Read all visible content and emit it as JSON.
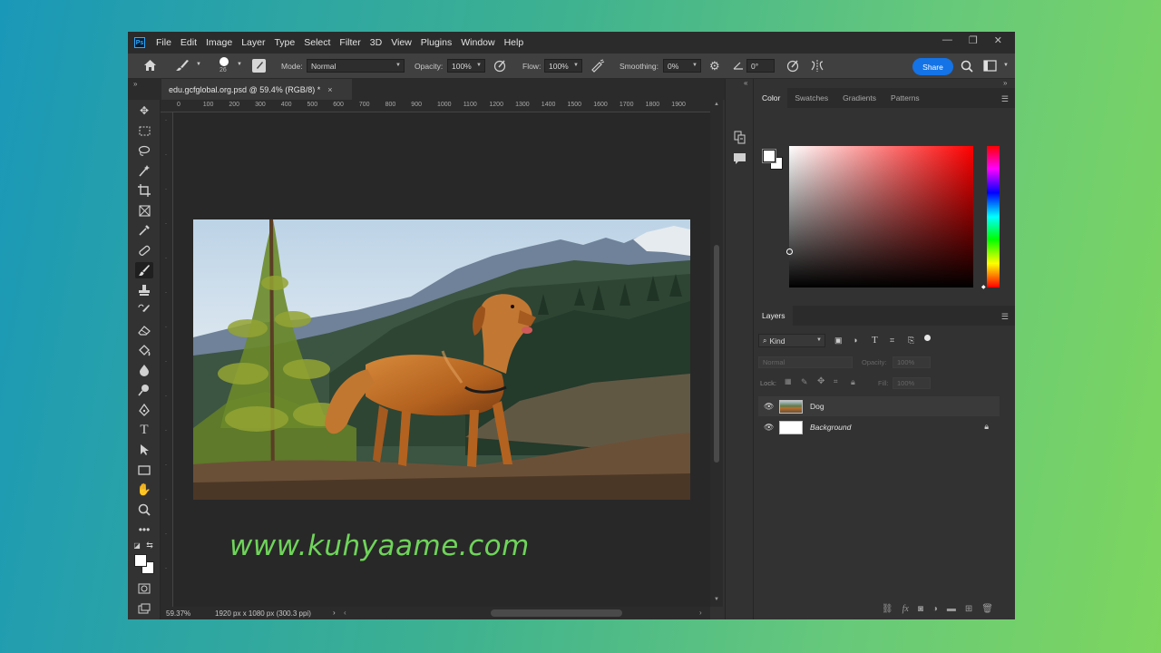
{
  "app": {
    "logo": "Ps",
    "menu": [
      "File",
      "Edit",
      "Image",
      "Layer",
      "Type",
      "Select",
      "Filter",
      "3D",
      "View",
      "Plugins",
      "Window",
      "Help"
    ],
    "window_controls": [
      "minimize-icon",
      "maximize-icon",
      "close-icon"
    ]
  },
  "options_bar": {
    "brush_size": "26",
    "mode_label": "Mode:",
    "mode_value": "Normal",
    "opacity_label": "Opacity:",
    "opacity_value": "100%",
    "flow_label": "Flow:",
    "flow_value": "100%",
    "smoothing_label": "Smoothing:",
    "smoothing_value": "0%",
    "angle_value": "0°",
    "share_label": "Share"
  },
  "document": {
    "tab_title": "edu.gcfglobal.org.psd @ 59.4% (RGB/8) *",
    "tab_close": "×",
    "ruler_top": [
      "0",
      "100",
      "200",
      "300",
      "400",
      "500",
      "600",
      "700",
      "800",
      "900",
      "1000",
      "1100",
      "1200",
      "1300",
      "1400",
      "1500",
      "1600",
      "1700",
      "1800",
      "1900"
    ],
    "zoom": "59.37%",
    "dimensions": "1920 px x 1080 px (300.3 ppi)",
    "status_arrow": "›"
  },
  "watermark": "www.kuhyaame.com",
  "color_panel": {
    "tabs": [
      "Color",
      "Swatches",
      "Gradients",
      "Patterns"
    ],
    "active_tab": "Color",
    "foreground": "#ffffff",
    "background": "#ffffff"
  },
  "layers_panel": {
    "title": "Layers",
    "filter_kind": "Kind",
    "blend_mode": "Normal",
    "opacity_label": "Opacity:",
    "opacity_value": "100%",
    "lock_label": "Lock:",
    "fill_label": "Fill:",
    "fill_value": "100%",
    "layers": [
      {
        "name": "Dog",
        "visible": true,
        "locked": false
      },
      {
        "name": "Background",
        "visible": true,
        "locked": true
      }
    ]
  },
  "colors": {
    "accent": "#1473e6",
    "watermark": "#6fd45a"
  }
}
